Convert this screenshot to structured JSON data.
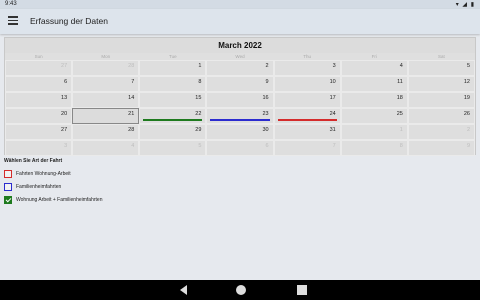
{
  "status": {
    "time": "9:43",
    "icons": "▾ ◢ ▮"
  },
  "app": {
    "title": "Erfassung der Daten"
  },
  "calendar": {
    "month_title": "March 2022",
    "weekdays": [
      "Sun",
      "Mon",
      "Tue",
      "Wed",
      "Thu",
      "Fri",
      "Sat"
    ],
    "weeks": [
      [
        {
          "n": "27",
          "out": true
        },
        {
          "n": "28",
          "out": true
        },
        {
          "n": "1"
        },
        {
          "n": "2"
        },
        {
          "n": "3"
        },
        {
          "n": "4"
        },
        {
          "n": "5"
        }
      ],
      [
        {
          "n": "6"
        },
        {
          "n": "7"
        },
        {
          "n": "8"
        },
        {
          "n": "9"
        },
        {
          "n": "10"
        },
        {
          "n": "11"
        },
        {
          "n": "12"
        }
      ],
      [
        {
          "n": "13"
        },
        {
          "n": "14"
        },
        {
          "n": "15"
        },
        {
          "n": "16"
        },
        {
          "n": "17"
        },
        {
          "n": "18"
        },
        {
          "n": "19"
        }
      ],
      [
        {
          "n": "20"
        },
        {
          "n": "21",
          "selected": true
        },
        {
          "n": "22",
          "bar": "#1e7a1e"
        },
        {
          "n": "23",
          "bar": "#2b2bcf"
        },
        {
          "n": "24",
          "bar": "#d42b2b"
        },
        {
          "n": "25"
        },
        {
          "n": "26"
        }
      ],
      [
        {
          "n": "27"
        },
        {
          "n": "28"
        },
        {
          "n": "29"
        },
        {
          "n": "30"
        },
        {
          "n": "31"
        },
        {
          "n": "1",
          "out": true
        },
        {
          "n": "2",
          "out": true
        }
      ],
      [
        {
          "n": "3",
          "out": true
        },
        {
          "n": "4",
          "out": true
        },
        {
          "n": "5",
          "out": true
        },
        {
          "n": "6",
          "out": true
        },
        {
          "n": "7",
          "out": true
        },
        {
          "n": "8",
          "out": true
        },
        {
          "n": "9",
          "out": true
        }
      ]
    ]
  },
  "legend": {
    "heading": "Wählen Sie Art der Fahrt",
    "items": [
      {
        "label": "Fahrten Wohnung-Arbeit",
        "color": "#d42b2b",
        "checked": false
      },
      {
        "label": "Familienheimfahrten",
        "color": "#2b2bcf",
        "checked": false
      },
      {
        "label": "Wohnung Arbeit + Familienheimfahrten",
        "color": "#1e7a1e",
        "checked": true
      }
    ]
  }
}
